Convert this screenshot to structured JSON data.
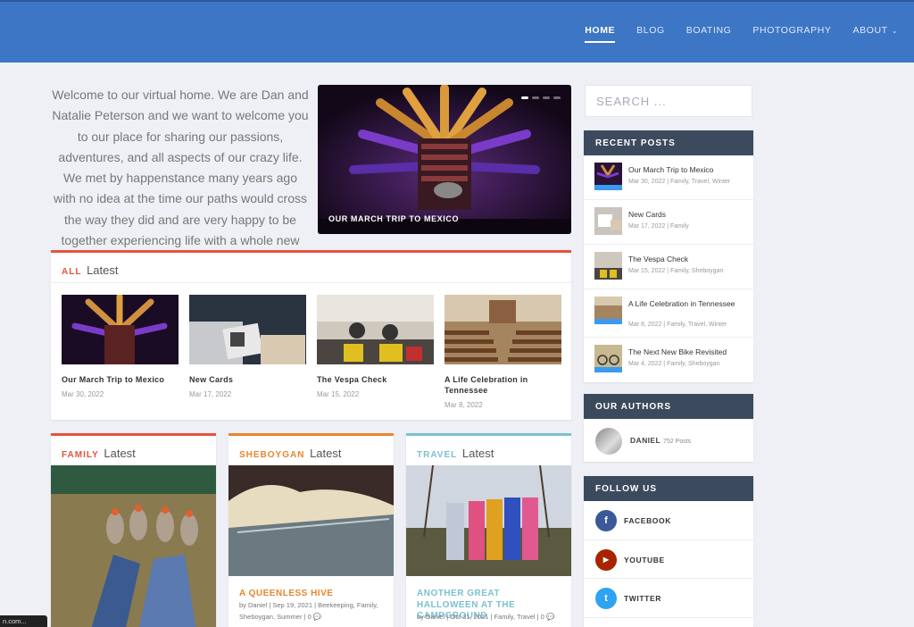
{
  "nav": [
    {
      "label": "HOME",
      "active": true
    },
    {
      "label": "BLOG"
    },
    {
      "label": "BOATING"
    },
    {
      "label": "PHOTOGRAPHY"
    },
    {
      "label": "ABOUT"
    }
  ],
  "welcome_text": "Welcome to our virtual home.  We are Dan and Natalie Peterson and we want to welcome you to our place for sharing our passions, adventures, and all aspects of our crazy life.  We met by happenstance many years ago with no idea at the time our paths would cross the way they did and are very happy to be together experiencing life with a whole new outlook",
  "hero": {
    "caption": "OUR MARCH TRIP TO MEXICO"
  },
  "latest_box": {
    "cat": "ALL",
    "suffix": "Latest",
    "items": [
      {
        "title": "Our March Trip to Mexico",
        "date": "Mar 30, 2022"
      },
      {
        "title": "New Cards",
        "date": "Mar 17, 2022"
      },
      {
        "title": "The Vespa Check",
        "date": "Mar 15, 2022"
      },
      {
        "title": "A Life Celebration in Tennessee",
        "date": "Mar 8, 2022"
      }
    ]
  },
  "cat_boxes": [
    {
      "cat": "FAMILY",
      "suffix": "Latest",
      "color": "#e5533d",
      "post_title": "",
      "meta": ""
    },
    {
      "cat": "SHEBOYGAN",
      "suffix": "Latest",
      "color": "#e8862e",
      "post_title": "A QUEENLESS HIVE",
      "meta": "by Daniel | Sep 19, 2021 | Beekeeping, Family, Sheboygan, Summer | 0"
    },
    {
      "cat": "TRAVEL",
      "suffix": "Latest",
      "color": "#7cc1d1",
      "post_title": "ANOTHER GREAT HALLOWEEN AT THE CAMPGROUND",
      "meta": "by Daniel | Oct 31, 2021 | Family, Travel | 0"
    }
  ],
  "search": {
    "placeholder": "SEARCH ..."
  },
  "recent_posts": {
    "heading": "RECENT POSTS",
    "items": [
      {
        "title": "Our March Trip to Mexico",
        "meta": "Mar 30, 2022 | Family, Travel, Winter"
      },
      {
        "title": "New Cards",
        "meta": "Mar 17, 2022 | Family"
      },
      {
        "title": "The Vespa Check",
        "meta": "Mar 15, 2022 | Family, Sheboygan"
      },
      {
        "title": "A Life Celebration in Tennessee",
        "meta": "Mar 8, 2022 | Family, Travel, Winter"
      },
      {
        "title": "The Next New Bike Revisited",
        "meta": "Mar 4, 2022 | Family, Sheboygan"
      }
    ]
  },
  "authors": {
    "heading": "OUR AUTHORS",
    "name": "DANIEL",
    "count": "752 Posts"
  },
  "follow": {
    "heading": "FOLLOW US",
    "items": [
      {
        "label": "FACEBOOK",
        "glyph": "f",
        "color": "#3b5998"
      },
      {
        "label": "YOUTUBE",
        "glyph": "▶",
        "color": "#a82400"
      },
      {
        "label": "TWITTER",
        "glyph": "t",
        "color": "#2ea3f2"
      }
    ]
  },
  "status_text": "n.com..."
}
